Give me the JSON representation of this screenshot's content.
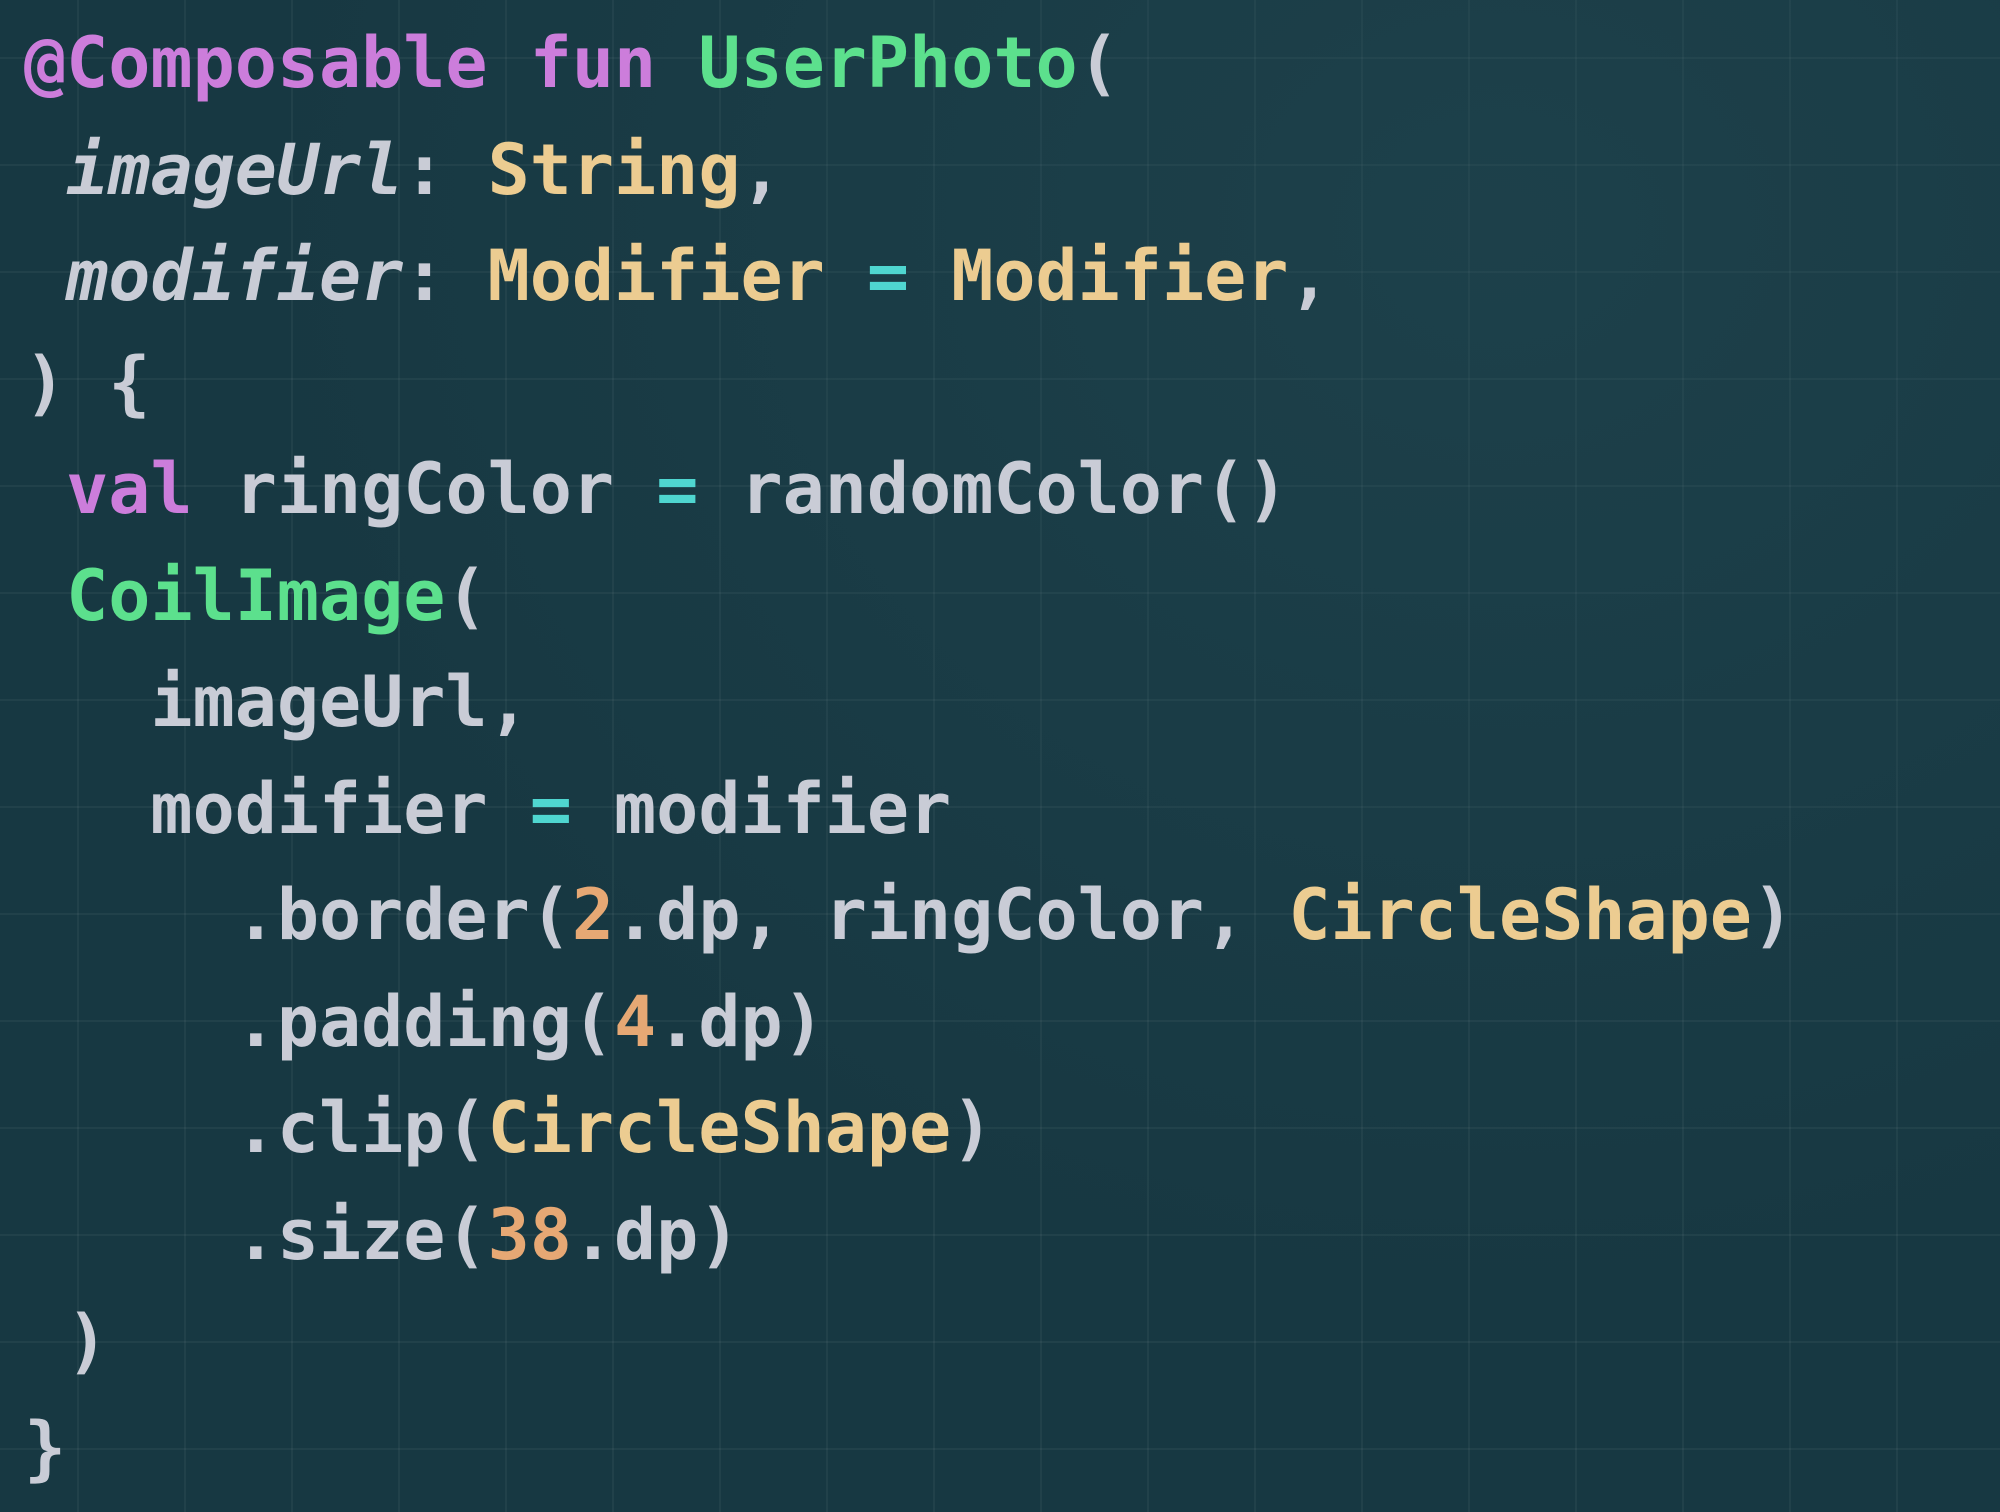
{
  "code": {
    "language": "kotlin",
    "colors": {
      "background": "#173842",
      "keyword": "#cc7ddb",
      "function": "#5ce08d",
      "type": "#eccc91",
      "operator": "#4fd6d0",
      "number": "#e6a874",
      "plain": "#c9ccd6"
    },
    "lines": [
      [
        {
          "t": "@Composable",
          "k": "kw"
        },
        {
          "t": " ",
          "k": "pl"
        },
        {
          "t": "fun",
          "k": "kw"
        },
        {
          "t": " ",
          "k": "pl"
        },
        {
          "t": "UserPhoto",
          "k": "fn"
        },
        {
          "t": "(",
          "k": "pl"
        }
      ],
      [
        {
          "t": " ",
          "k": "pl"
        },
        {
          "t": "imageUrl",
          "k": "pr"
        },
        {
          "t": ": ",
          "k": "pl"
        },
        {
          "t": "String",
          "k": "ty"
        },
        {
          "t": ",",
          "k": "pl"
        }
      ],
      [
        {
          "t": " ",
          "k": "pl"
        },
        {
          "t": "modifier",
          "k": "pr"
        },
        {
          "t": ": ",
          "k": "pl"
        },
        {
          "t": "Modifier",
          "k": "ty"
        },
        {
          "t": " ",
          "k": "pl"
        },
        {
          "t": "=",
          "k": "op"
        },
        {
          "t": " ",
          "k": "pl"
        },
        {
          "t": "Modifier",
          "k": "ty"
        },
        {
          "t": ",",
          "k": "pl"
        }
      ],
      [
        {
          "t": ") {",
          "k": "pl"
        }
      ],
      [
        {
          "t": " ",
          "k": "pl"
        },
        {
          "t": "val",
          "k": "kw"
        },
        {
          "t": " ringColor ",
          "k": "pl"
        },
        {
          "t": "=",
          "k": "op"
        },
        {
          "t": " randomColor()",
          "k": "pl"
        }
      ],
      [
        {
          "t": " ",
          "k": "pl"
        },
        {
          "t": "CoilImage",
          "k": "fn"
        },
        {
          "t": "(",
          "k": "pl"
        }
      ],
      [
        {
          "t": "   imageUrl,",
          "k": "pl"
        }
      ],
      [
        {
          "t": "   modifier ",
          "k": "pl"
        },
        {
          "t": "=",
          "k": "op"
        },
        {
          "t": " modifier",
          "k": "pl"
        }
      ],
      [
        {
          "t": "     .border(",
          "k": "pl"
        },
        {
          "t": "2",
          "k": "num"
        },
        {
          "t": ".dp, ringColor, ",
          "k": "pl"
        },
        {
          "t": "CircleShape",
          "k": "ty"
        },
        {
          "t": ")",
          "k": "pl"
        }
      ],
      [
        {
          "t": "     .padding(",
          "k": "pl"
        },
        {
          "t": "4",
          "k": "num"
        },
        {
          "t": ".dp)",
          "k": "pl"
        }
      ],
      [
        {
          "t": "     .clip(",
          "k": "pl"
        },
        {
          "t": "CircleShape",
          "k": "ty"
        },
        {
          "t": ")",
          "k": "pl"
        }
      ],
      [
        {
          "t": "     .size(",
          "k": "pl"
        },
        {
          "t": "38",
          "k": "num"
        },
        {
          "t": ".dp)",
          "k": "pl"
        }
      ],
      [
        {
          "t": " )",
          "k": "pl"
        }
      ],
      [
        {
          "t": "}",
          "k": "pl"
        }
      ]
    ]
  }
}
